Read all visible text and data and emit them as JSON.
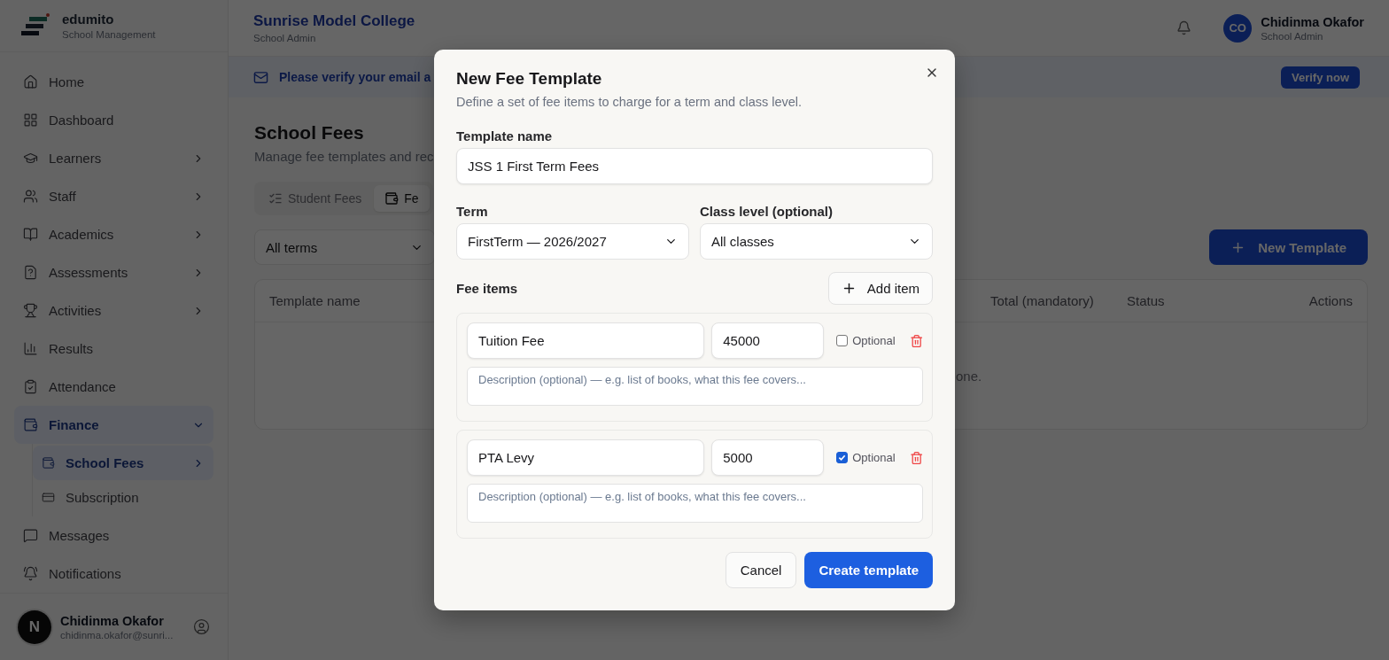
{
  "sidebar": {
    "brand": {
      "name": "edumito",
      "tagline": "School Management"
    },
    "items": [
      {
        "label": "Home",
        "selected": false
      },
      {
        "label": "Dashboard",
        "selected": false
      },
      {
        "label": "Learners",
        "selected": false,
        "expanded": false
      },
      {
        "label": "Staff",
        "selected": false,
        "expanded": false
      },
      {
        "label": "Academics",
        "selected": false,
        "expanded": false
      },
      {
        "label": "Assessments",
        "selected": false,
        "expanded": false
      },
      {
        "label": "Activities",
        "selected": false,
        "expanded": false
      },
      {
        "label": "Results",
        "selected": false
      },
      {
        "label": "Attendance",
        "selected": false
      },
      {
        "label": "Finance",
        "selected": true,
        "expanded": true,
        "children": [
          {
            "label": "School Fees",
            "selected": true,
            "expanded": false
          },
          {
            "label": "Subscription",
            "selected": false
          }
        ]
      },
      {
        "label": "Messages",
        "selected": false
      },
      {
        "label": "Notifications",
        "selected": false
      }
    ],
    "user": {
      "avatar": "N",
      "name": "Chidinma Okafor",
      "email": "chidinma.okafor@sunri..."
    }
  },
  "header": {
    "title": "Sunrise Model College",
    "subtitle": "School Admin",
    "user": {
      "initials": "CO",
      "name": "Chidinma Okafor",
      "role": "School Admin"
    }
  },
  "banner": {
    "text": "Please verify your email a",
    "button": "Verify now"
  },
  "page": {
    "title": "School Fees",
    "subtitle": "Manage fee templates and rec",
    "tabs": [
      {
        "label": "Student Fees",
        "selected": false
      },
      {
        "label": "Fe",
        "selected": true
      }
    ],
    "filter": "All terms",
    "new_button": "New Template"
  },
  "table": {
    "columns": [
      {
        "label": "Template name"
      },
      {
        "label": "Total (mandatory)"
      },
      {
        "label": "Status"
      },
      {
        "label": "Actions"
      }
    ],
    "empty_text": "one."
  },
  "modal": {
    "title": "New Fee Template",
    "description": "Define a set of fee items to charge for a term and class level.",
    "template_name": {
      "label": "Template name",
      "value": "JSS 1 First Term Fees"
    },
    "term": {
      "label": "Term",
      "value": "FirstTerm — 2026/2027"
    },
    "class_level": {
      "label": "Class level (optional)",
      "value": "All classes"
    },
    "fee_items_label": "Fee items",
    "add_button": "Add item",
    "items": [
      {
        "name": "Tuition Fee",
        "amount": "45000",
        "optional_label": "Optional",
        "optional": false,
        "description_placeholder": "Description (optional) — e.g. list of books, what this fee covers..."
      },
      {
        "name": "PTA Levy",
        "amount": "5000",
        "optional_label": "Optional",
        "optional": true,
        "description_placeholder": "Description (optional) — e.g. list of books, what this fee covers..."
      }
    ],
    "cancel": "Cancel",
    "submit": "Create template"
  }
}
